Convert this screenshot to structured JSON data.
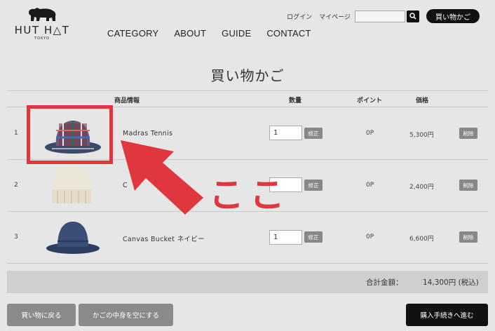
{
  "brand": {
    "name": "HUT H△T",
    "sub": "TOKYO",
    "logo_icon": "bear-icon"
  },
  "nav": [
    "CATEGORY",
    "ABOUT",
    "GUIDE",
    "CONTACT"
  ],
  "util": {
    "login": "ログイン",
    "mypage": "マイページ",
    "search_placeholder": "",
    "cart": "買い物かご"
  },
  "page_title": "買い物かご",
  "table": {
    "headers": {
      "product": "商品情報",
      "qty": "数量",
      "points": "ポイント",
      "price": "価格"
    },
    "edit_label": "修正",
    "delete_label": "削除",
    "rows": [
      {
        "num": "1",
        "name": "Madras Tennis",
        "qty": "1",
        "points": "0P",
        "price": "5,300円"
      },
      {
        "num": "2",
        "name": "C",
        "qty": "",
        "points": "0P",
        "price": "2,400円"
      },
      {
        "num": "3",
        "name": "Canvas Bucket ネイビー",
        "qty": "1",
        "points": "0P",
        "price": "6,600円"
      }
    ]
  },
  "total": {
    "label": "合計金額：",
    "value": "14,300円 (税込)"
  },
  "buttons": {
    "back": "買い物に戻る",
    "empty": "かごの中身を空にする",
    "checkout": "購入手続きへ進む"
  },
  "annotation": {
    "text": "ここ",
    "color": "#e0373e"
  }
}
